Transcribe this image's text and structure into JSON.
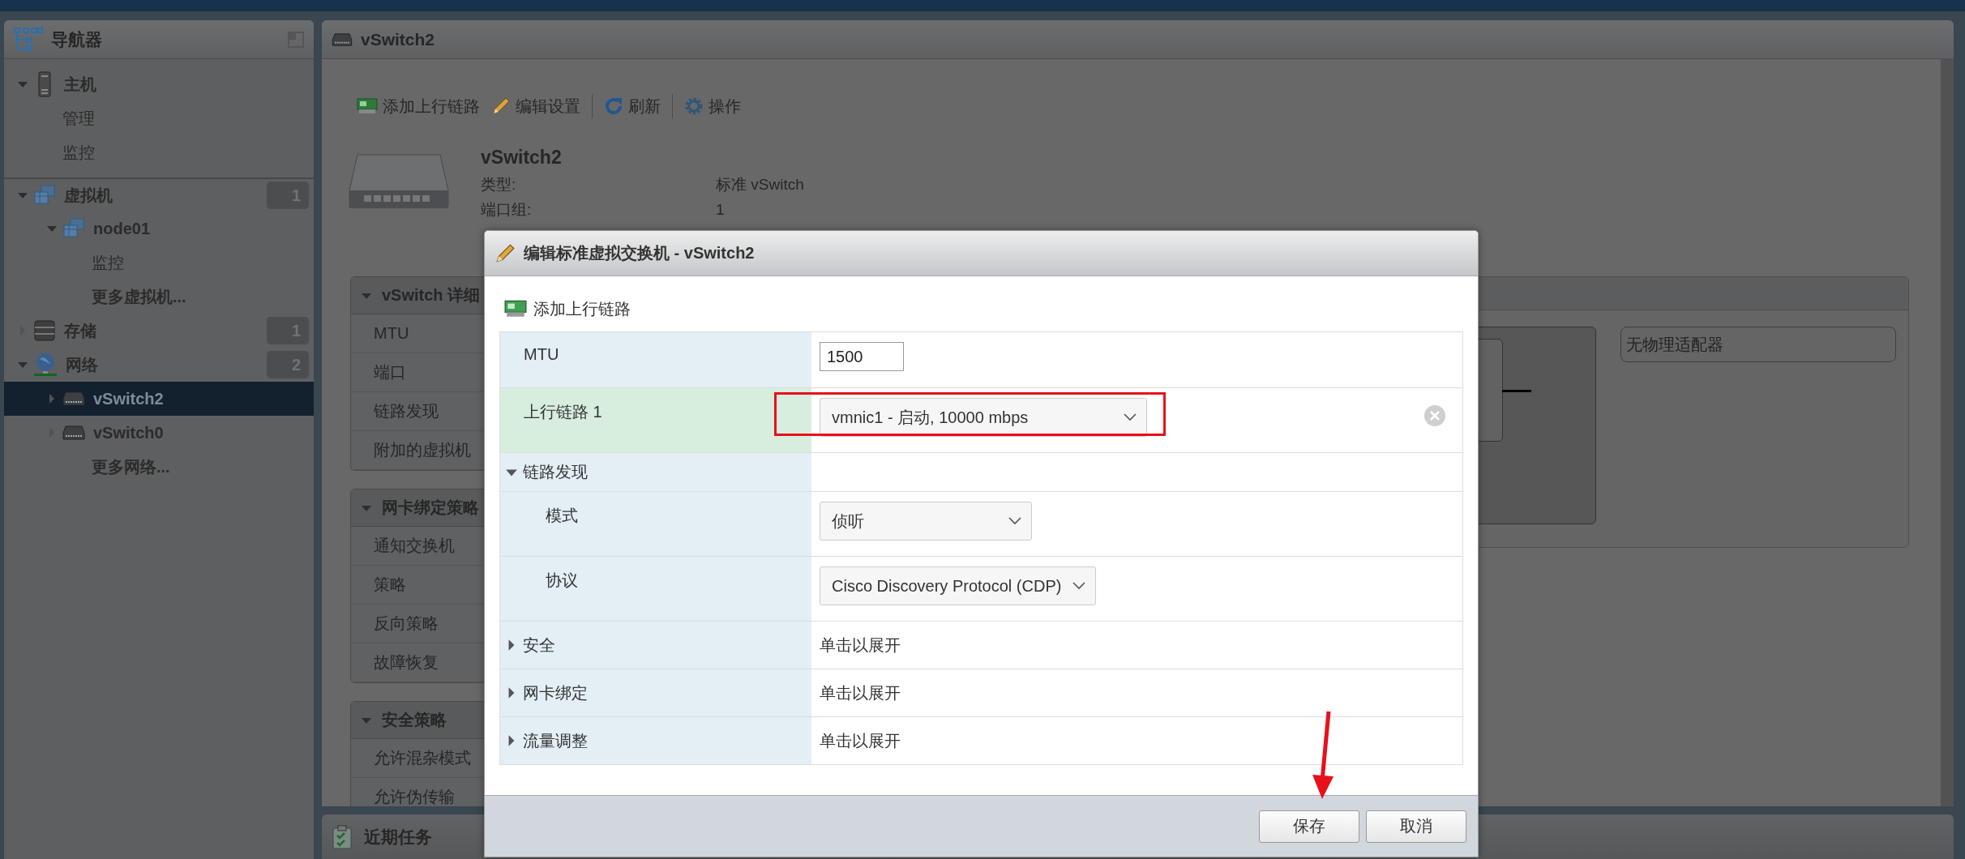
{
  "navigator": {
    "title": "导航器",
    "items": [
      {
        "label": "主机",
        "kind": "host",
        "expanded": true,
        "selected": false,
        "children": [
          {
            "label": "管理",
            "kind": "link",
            "selected": false
          },
          {
            "label": "监控",
            "kind": "link",
            "selected": false
          }
        ]
      },
      {
        "label": "虚拟机",
        "kind": "vm",
        "expanded": true,
        "selected": false,
        "count": "1",
        "children": [
          {
            "label": "node01",
            "kind": "vm",
            "expanded": true,
            "selected": false,
            "children": [
              {
                "label": "监控",
                "kind": "link",
                "selected": false
              }
            ]
          },
          {
            "label": "更多虚拟机...",
            "kind": "more",
            "selected": false
          }
        ]
      },
      {
        "label": "存储",
        "kind": "storage",
        "expanded": false,
        "selected": false,
        "count": "1"
      },
      {
        "label": "网络",
        "kind": "network",
        "expanded": true,
        "selected": false,
        "count": "2",
        "children": [
          {
            "label": "vSwitch2",
            "kind": "switch",
            "expanded": false,
            "selected": true
          },
          {
            "label": "vSwitch0",
            "kind": "switch",
            "expanded": false,
            "selected": false
          },
          {
            "label": "更多网络...",
            "kind": "more",
            "selected": false
          }
        ]
      }
    ]
  },
  "main": {
    "title": "vSwitch2",
    "toolbar": [
      {
        "label": "添加上行链路",
        "kind": "uplink",
        "separator_before": false
      },
      {
        "label": "编辑设置",
        "kind": "edit",
        "separator_before": false
      },
      {
        "label": "刷新",
        "kind": "refresh",
        "separator_before": true
      },
      {
        "label": "操作",
        "kind": "actions",
        "separator_before": true
      }
    ],
    "summary": {
      "name": "vSwitch2",
      "fields": [
        {
          "label": "类型:",
          "value": "标准 vSwitch"
        },
        {
          "label": "端口组:",
          "value": "1"
        }
      ]
    },
    "sections": [
      {
        "title": "vSwitch 详细",
        "expanded": true,
        "rows": [
          "MTU",
          "端口",
          "链路发现",
          "附加的虚拟机"
        ]
      },
      {
        "title": "网卡绑定策略",
        "expanded": true,
        "rows": [
          "通知交换机",
          "策略",
          "反向策略",
          "故障恢复"
        ]
      },
      {
        "title": "安全策略",
        "expanded": true,
        "rows": [
          "允许混杂模式",
          "允许伪传输"
        ]
      }
    ],
    "topology": {
      "adapter": "无物理适配器"
    }
  },
  "recent_tasks": {
    "title": "近期任务"
  },
  "dialog": {
    "title": "编辑标准虚拟交换机 - vSwitch2",
    "add_uplink": "添加上行链路",
    "rows": [
      {
        "kind": "input",
        "label": "MTU",
        "value": "1500",
        "new": false,
        "marked": false,
        "removable": false
      },
      {
        "kind": "select",
        "label": "上行链路 1",
        "value": "vmnic1 - 启动, 10000 mbps",
        "new": true,
        "marked": true,
        "removable": true
      },
      {
        "kind": "group",
        "label": "链路发现",
        "expanded": true,
        "new": false,
        "marked": false,
        "removable": false,
        "children": [
          {
            "kind": "select",
            "label": "模式",
            "value": "侦听",
            "new": false,
            "marked": false,
            "removable": false
          },
          {
            "kind": "select",
            "label": "协议",
            "value": "Cisco Discovery Protocol (CDP)",
            "new": false,
            "marked": false,
            "removable": false
          }
        ]
      },
      {
        "kind": "group",
        "label": "安全",
        "expanded": false,
        "value": "单击以展开",
        "new": false,
        "marked": false,
        "removable": false
      },
      {
        "kind": "group",
        "label": "网卡绑定",
        "expanded": false,
        "value": "单击以展开",
        "new": false,
        "marked": false,
        "removable": false
      },
      {
        "kind": "group",
        "label": "流量调整",
        "expanded": false,
        "value": "单击以展开",
        "new": false,
        "marked": false,
        "removable": false
      }
    ],
    "buttons": [
      {
        "label": "保存",
        "pointed": true
      },
      {
        "label": "取消",
        "pointed": false
      }
    ]
  }
}
